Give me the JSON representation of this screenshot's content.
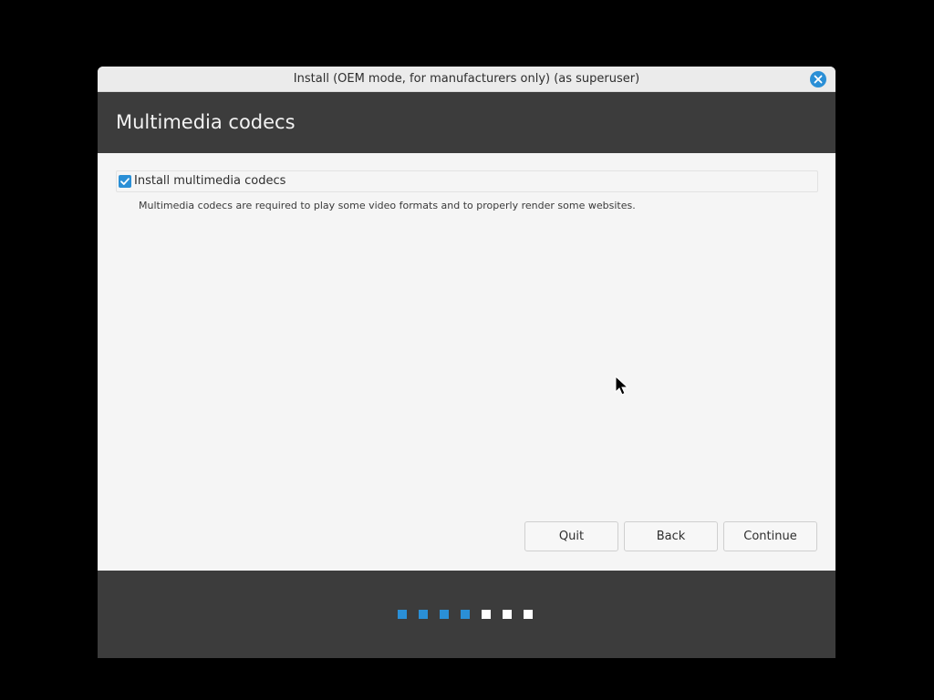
{
  "window": {
    "title": "Install (OEM mode, for manufacturers only) (as superuser)"
  },
  "header": {
    "title": "Multimedia codecs"
  },
  "option": {
    "label": "Install multimedia codecs",
    "checked": true,
    "description": "Multimedia codecs are required to play some video formats and to properly render some websites."
  },
  "buttons": {
    "quit": "Quit",
    "back": "Back",
    "continue": "Continue"
  },
  "progress": {
    "total_steps": 7,
    "completed_steps": 4,
    "completed_color": "#2a8fd6",
    "pending_color": "#ffffff"
  },
  "colors": {
    "accent": "#2a8fd6",
    "header_bg": "#3c3c3c",
    "content_bg": "#f5f5f5"
  }
}
